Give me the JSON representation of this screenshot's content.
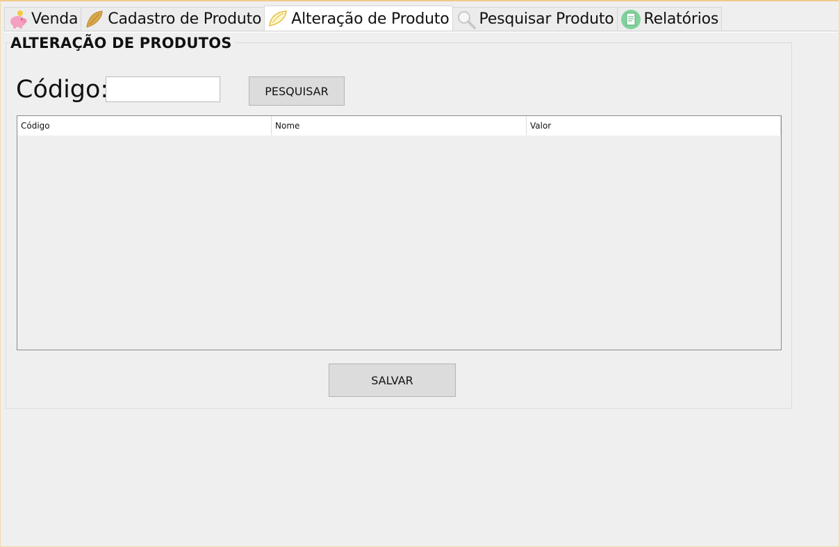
{
  "tabs": [
    {
      "label": "Venda",
      "icon": "piggy-bank-icon",
      "active": false
    },
    {
      "label": "Cadastro de Produto",
      "icon": "pastry-icon",
      "active": false
    },
    {
      "label": "Alteração de Produto",
      "icon": "pastry-outline-icon",
      "active": true
    },
    {
      "label": "Pesquisar Produto",
      "icon": "magnifier-icon",
      "active": false
    },
    {
      "label": "Relatórios",
      "icon": "report-icon",
      "active": false
    }
  ],
  "panel": {
    "title": "ALTERAÇÃO DE PRODUTOS",
    "codigo_label": "Código:",
    "codigo_value": "",
    "search_button": "PESQUISAR",
    "save_button": "SALVAR"
  },
  "table": {
    "columns": [
      "Código",
      "Nome",
      "Valor"
    ],
    "rows": []
  },
  "colors": {
    "background": "#efefef",
    "piggy": "#f4a0c0",
    "pastry": "#d9a84a",
    "report": "#7fd29b"
  }
}
